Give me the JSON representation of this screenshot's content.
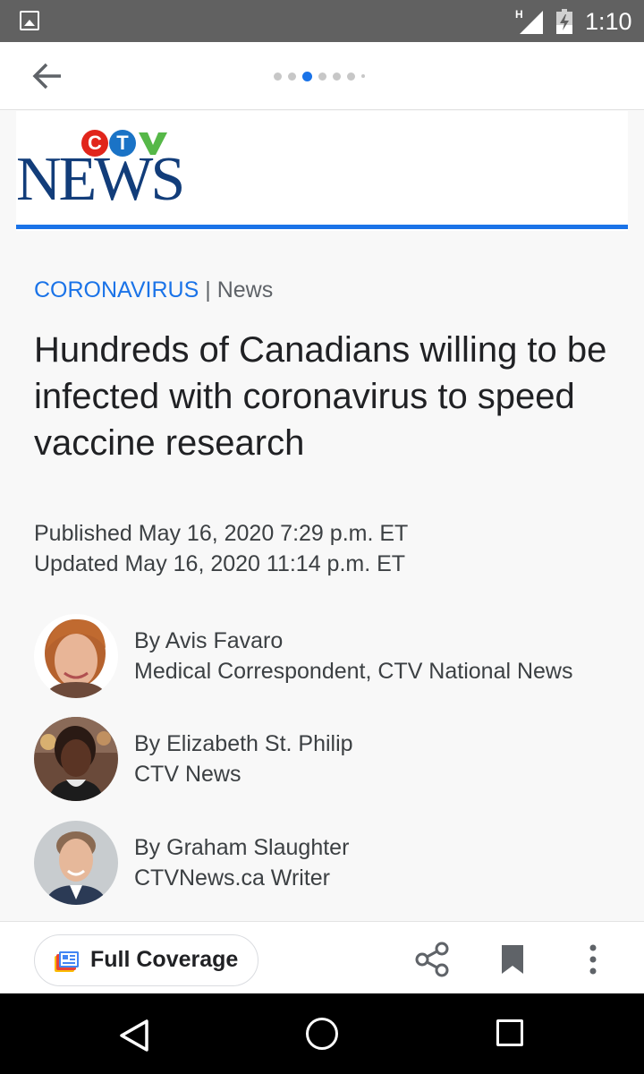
{
  "status_bar": {
    "network_type": "H",
    "time": "1:10"
  },
  "top_bar": {
    "back_icon": "arrow-back-icon",
    "pagination": {
      "total_dots": 7,
      "active_index": 2
    }
  },
  "logo": {
    "letters": [
      "C",
      "T",
      "V"
    ],
    "word": "NEWS",
    "colors": {
      "c": "#e1251b",
      "t": "#1a73c6",
      "v": "#56b848",
      "news": "#123d7a"
    }
  },
  "article": {
    "category": "CORONAVIRUS",
    "separator": "|",
    "section": "News",
    "headline": "Hundreds of Canadians willing to be infected with coronavirus to speed vaccine research",
    "published": "Published May 16, 2020 7:29 p.m. ET",
    "updated": "Updated May 16, 2020 11:14 p.m. ET",
    "authors": [
      {
        "byline": "By Avis Favaro",
        "role": "Medical Correspondent, CTV National News"
      },
      {
        "byline": "By Elizabeth St. Philip",
        "role": "CTV News"
      },
      {
        "byline": "By Graham Slaughter",
        "role": "CTVNews.ca Writer"
      }
    ]
  },
  "action_bar": {
    "full_coverage_label": "Full Coverage",
    "icons": [
      "full-coverage-icon",
      "share-icon",
      "bookmark-icon",
      "more-vert-icon"
    ]
  },
  "nav_bar": {
    "icons": [
      "nav-back-icon",
      "nav-home-icon",
      "nav-recents-icon"
    ]
  },
  "colors": {
    "accent": "#1a73e8",
    "status_bar": "#616161"
  }
}
